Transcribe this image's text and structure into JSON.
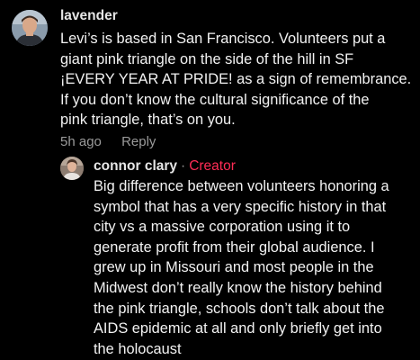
{
  "main_comment": {
    "username": "lavender",
    "text_lines": [
      "Levi’s is based in San Francisco. Volunteers put a",
      "giant pink triangle on the side of the hill in SF",
      "¡EVERY YEAR AT PRIDE! as a sign of remembrance.",
      "If you don’t know the cultural significance of the",
      "pink triangle, that’s on you."
    ],
    "timestamp": "5h ago",
    "reply_label": "Reply"
  },
  "reply_comment": {
    "username": "connor clary",
    "separator": "·",
    "badge": "Creator",
    "text_lines": [
      "Big difference between volunteers honoring a",
      "symbol that has a very specific history in that",
      "city vs a massive corporation using it to",
      "generate profit from their global audience. I",
      "grew up in Missouri and most people in the",
      "Midwest don’t really know the history behind",
      "the pink triangle, schools don’t talk about the",
      "AIDS epidemic at all and only briefly get into",
      "the holocaust"
    ]
  },
  "colors": {
    "background": "#000000",
    "text": "#f2f2f2",
    "muted": "#9a9a9a",
    "creator_accent": "#fe2c55"
  },
  "icons": {
    "main_avatar": "user-photo",
    "reply_avatar": "user-photo"
  }
}
